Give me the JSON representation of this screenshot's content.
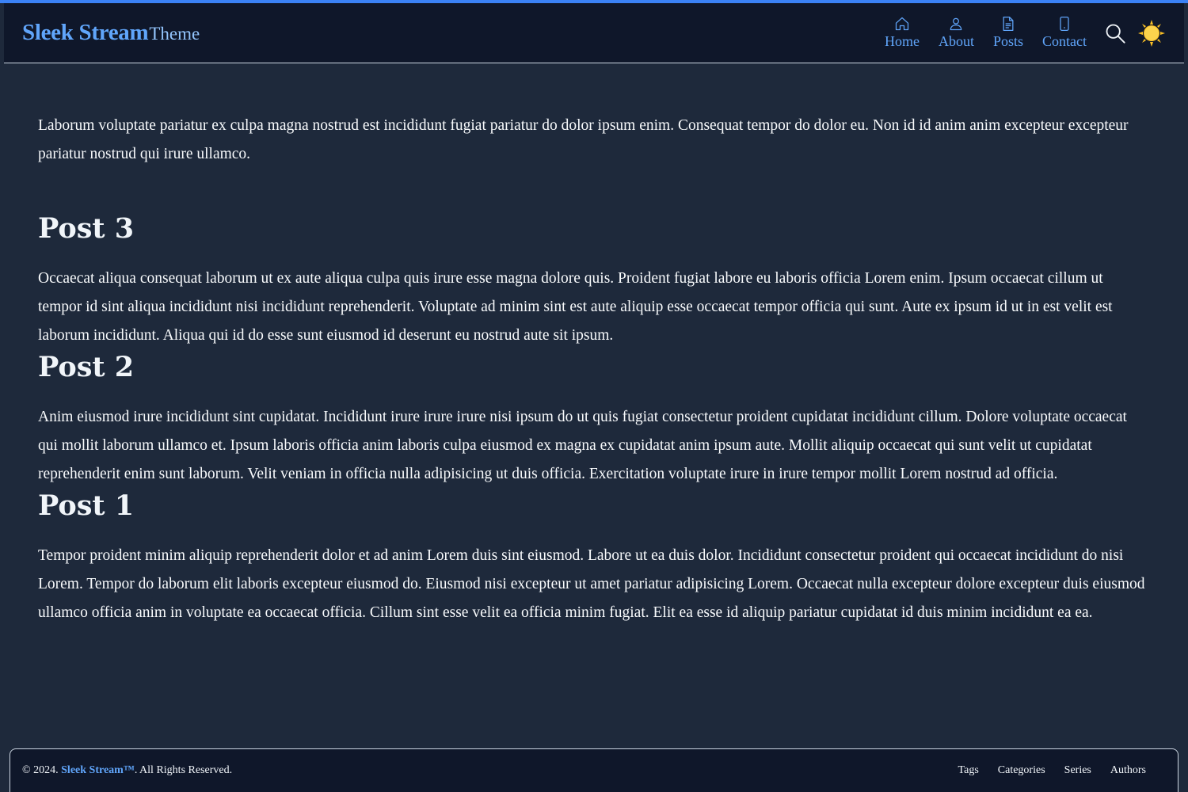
{
  "header": {
    "brand_name": "Sleek Stream",
    "brand_suffix": "Theme",
    "nav": [
      {
        "label": "Home",
        "icon": "home-icon"
      },
      {
        "label": "About",
        "icon": "user-icon"
      },
      {
        "label": "Posts",
        "icon": "document-icon"
      },
      {
        "label": "Contact",
        "icon": "phone-icon"
      }
    ],
    "search_icon": "search-icon",
    "theme_icon": "sun-icon"
  },
  "main": {
    "intro": "Laborum voluptate pariatur ex culpa magna nostrud est incididunt fugiat pariatur do dolor ipsum enim. Consequat tempor do dolor eu. Non id id anim anim excepteur excepteur pariatur nostrud qui irure ullamco.",
    "posts": [
      {
        "title": "Post 3",
        "body": "Occaecat aliqua consequat laborum ut ex aute aliqua culpa quis irure esse magna dolore quis. Proident fugiat labore eu laboris officia Lorem enim. Ipsum occaecat cillum ut tempor id sint aliqua incididunt nisi incididunt reprehenderit. Voluptate ad minim sint est aute aliquip esse occaecat tempor officia qui sunt. Aute ex ipsum id ut in est velit est laborum incididunt. Aliqua qui id do esse sunt eiusmod id deserunt eu nostrud aute sit ipsum."
      },
      {
        "title": "Post 2",
        "body": "Anim eiusmod irure incididunt sint cupidatat. Incididunt irure irure irure nisi ipsum do ut quis fugiat consectetur proident cupidatat incididunt cillum. Dolore voluptate occaecat qui mollit laborum ullamco et. Ipsum laboris officia anim laboris culpa eiusmod ex magna ex cupidatat anim ipsum aute. Mollit aliquip occaecat qui sunt velit ut cupidatat reprehenderit enim sunt laborum. Velit veniam in officia nulla adipisicing ut duis officia. Exercitation voluptate irure in irure tempor mollit Lorem nostrud ad officia."
      },
      {
        "title": "Post 1",
        "body": "Tempor proident minim aliquip reprehenderit dolor et ad anim Lorem duis sint eiusmod. Labore ut ea duis dolor. Incididunt consectetur proident qui occaecat incididunt do nisi Lorem. Tempor do laborum elit laboris excepteur eiusmod do. Eiusmod nisi excepteur ut amet pariatur adipisicing Lorem. Occaecat nulla excepteur dolore excepteur duis eiusmod ullamco officia anim in voluptate ea occaecat officia. Cillum sint esse velit ea officia minim fugiat. Elit ea esse id aliquip pariatur cupidatat id duis minim incididunt ea ea."
      }
    ]
  },
  "footer": {
    "copyright_prefix": "© 2024.",
    "copyright_brand": "Sleek Stream™",
    "copyright_suffix": ". All Rights Reserved.",
    "links": [
      "Tags",
      "Categories",
      "Series",
      "Authors"
    ]
  },
  "colors": {
    "background": "#1e293b",
    "header_bg": "#0f172a",
    "accent": "#60a5fa",
    "top_bar": "#3b82f6",
    "sun": "#fbbf24"
  }
}
